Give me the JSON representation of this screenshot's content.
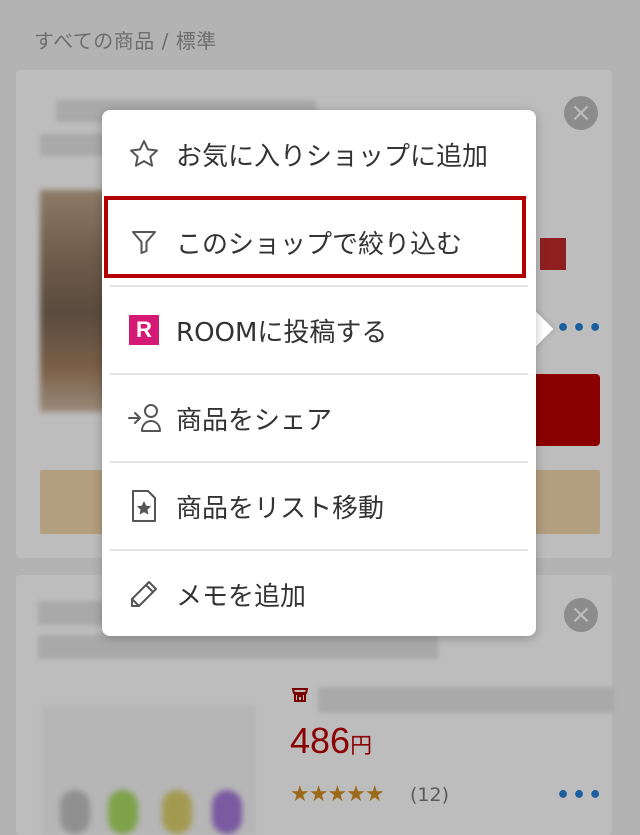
{
  "breadcrumb": "すべての商品 / 標準",
  "menu": {
    "items": [
      {
        "label": "お気に入りショップに追加",
        "icon": "star-outline-icon"
      },
      {
        "label": "このショップで絞り込む",
        "icon": "filter-icon",
        "highlighted": true
      },
      {
        "label": "ROOMに投稿する",
        "icon": "room-logo-icon",
        "logo_text": "R"
      },
      {
        "label": "商品をシェア",
        "icon": "share-person-icon"
      },
      {
        "label": "商品をリスト移動",
        "icon": "list-star-icon"
      },
      {
        "label": "メモを追加",
        "icon": "pencil-icon"
      }
    ]
  },
  "product2": {
    "price": "486",
    "currency": "円",
    "stars": "★★★★★",
    "review_count": "(12)"
  },
  "controls": {
    "close": "×",
    "more": "•••"
  },
  "colors": {
    "highlight": "#b30000",
    "price": "#8b0000",
    "room_brand": "#d41a75"
  }
}
